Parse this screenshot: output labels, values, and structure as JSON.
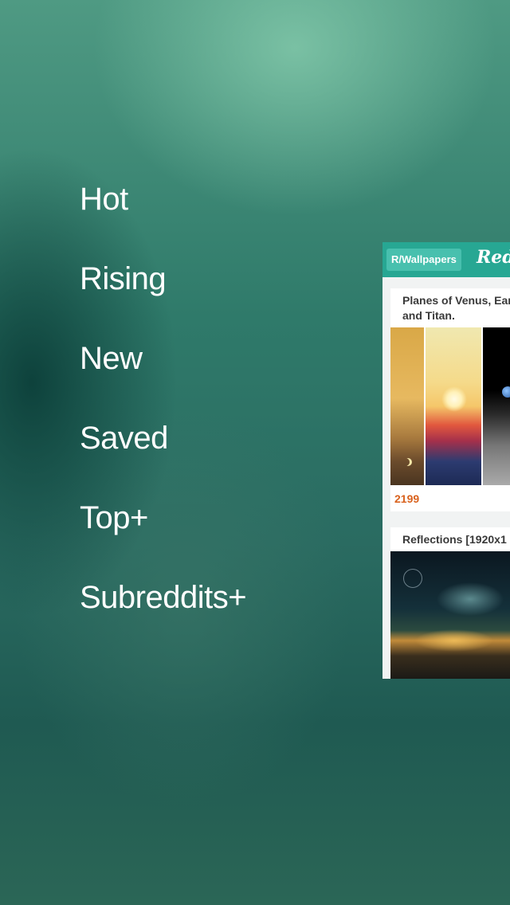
{
  "menu": {
    "items": [
      {
        "label": "Hot"
      },
      {
        "label": "Rising"
      },
      {
        "label": "New"
      },
      {
        "label": "Saved"
      },
      {
        "label": "Top+"
      },
      {
        "label": "Subreddits+"
      }
    ]
  },
  "preview": {
    "subreddit_badge": "R/Wallpapers",
    "app_logo": "Red",
    "posts": [
      {
        "title": "Planes of Venus, Earth and Titan.",
        "score": "2199"
      },
      {
        "title": "Reflections [1920x1",
        "score": ""
      }
    ]
  },
  "colors": {
    "header": "#27a793",
    "badge": "#48c0ae",
    "score": "#d9621e",
    "menu_text": "#ffffff"
  }
}
